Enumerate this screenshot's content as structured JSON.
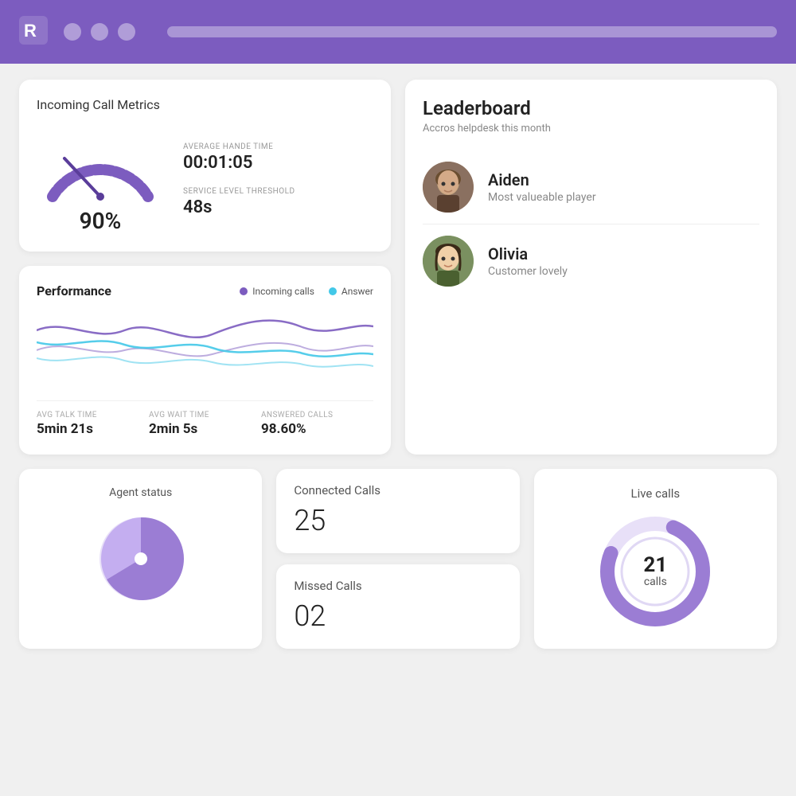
{
  "header": {
    "logo_alt": "R logo",
    "search_placeholder": ""
  },
  "metrics": {
    "title": "Incoming Call Metrics",
    "gauge_pct": "90%",
    "avg_handle_label": "AVERAGE HANDE TIME",
    "avg_handle_value": "00:01:05",
    "service_level_label": "SERVICE LEVEL THRESHOLD",
    "service_level_value": "48s"
  },
  "leaderboard": {
    "title": "Leaderboard",
    "subtitle": "Accros helpdesk this month",
    "entries": [
      {
        "name": "Aiden",
        "desc": "Most valueable player"
      },
      {
        "name": "Olivia",
        "desc": "Customer lovely"
      }
    ]
  },
  "performance": {
    "title": "Performance",
    "legend": [
      {
        "label": "Incoming calls",
        "color": "#7c5cbf"
      },
      {
        "label": "Answer",
        "color": "#42c8e8"
      }
    ],
    "stats": [
      {
        "label": "AVG TALK TIME",
        "value": "5min 21s"
      },
      {
        "label": "AVG WAIT TIME",
        "value": "2min 5s"
      },
      {
        "label": "ANSWERED CALLS",
        "value": "98.60%"
      }
    ]
  },
  "agent_status": {
    "title": "Agent status"
  },
  "connected_calls": {
    "label": "Connected Calls",
    "value": "25"
  },
  "missed_calls": {
    "label": "Missed Calls",
    "value": "02"
  },
  "live_calls": {
    "title": "Live calls",
    "value": "21",
    "unit": "calls"
  },
  "colors": {
    "purple": "#7c5cbf",
    "light_purple": "#9b7dd4",
    "cyan": "#42c8e8",
    "bg": "#f0f0f0"
  }
}
